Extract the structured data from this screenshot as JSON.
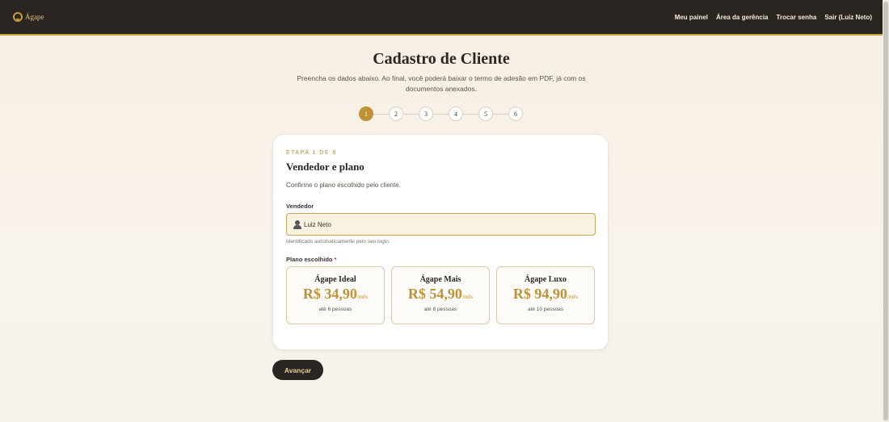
{
  "header": {
    "logo_text": "Ágape",
    "nav": [
      "Meu painel",
      "Área da gerência",
      "Trocar senha",
      "Sair (Luiz Neto)"
    ]
  },
  "page": {
    "title": "Cadastro de Cliente",
    "subtitle": "Preencha os dados abaixo. Ao final, você poderá baixar o termo de adesão em PDF, já com os documentos anexados."
  },
  "stepper": {
    "steps": [
      "1",
      "2",
      "3",
      "4",
      "5",
      "6"
    ],
    "current": 1
  },
  "card": {
    "eyebrow": "ETAPA 1 DE 6",
    "title": "Vendedor e plano",
    "description": "Confirme o plano escolhido pelo cliente.",
    "seller_label": "Vendedor",
    "seller_value": "Luiz Neto",
    "seller_hint": "Identificado automaticamente pelo seu login.",
    "plan_label": "Plano escolhido",
    "required_mark": "*",
    "plans": [
      {
        "name": "Ágape Ideal",
        "price": "R$ 34,90",
        "per": "/mês",
        "capacity": "até 6 pessoas"
      },
      {
        "name": "Ágape Mais",
        "price": "R$ 54,90",
        "per": "/mês",
        "capacity": "até 8 pessoas"
      },
      {
        "name": "Ágape Luxo",
        "price": "R$ 94,90",
        "per": "/mês",
        "capacity": "até 10 pessoas"
      }
    ]
  },
  "actions": {
    "next_label": "Avançar"
  },
  "colors": {
    "accent": "#bf9236",
    "topbar": "#2a2521",
    "input_bg": "#f9f2e0"
  }
}
